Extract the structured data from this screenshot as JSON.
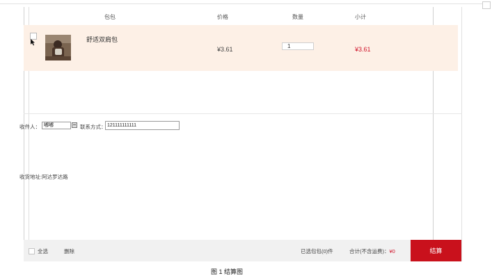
{
  "cart": {
    "headers": {
      "product": "包包",
      "price": "价格",
      "quantity": "数量",
      "subtotal": "小计"
    },
    "items": [
      {
        "name": "舒适双肩包",
        "price": "¥3.61",
        "quantity": "1",
        "subtotal": "¥3.61"
      }
    ]
  },
  "form": {
    "receiver_label": "收件人：",
    "receiver_value": "嘟嘟",
    "phone_label": "联系方式：",
    "phone_value": "121111111111",
    "address_label": "收货地址:阿达罗达路"
  },
  "footer": {
    "select_all": "全选",
    "delete": "删除",
    "selected_count": "已选包包(0)件",
    "total_label": "合计(不含运费)：",
    "total_value": "¥0",
    "checkout": "结算"
  },
  "caption": "图 1 结算图",
  "colors": {
    "accent": "#c9111c",
    "row_bg": "#fdf0e6",
    "price_red": "#d0142b"
  }
}
